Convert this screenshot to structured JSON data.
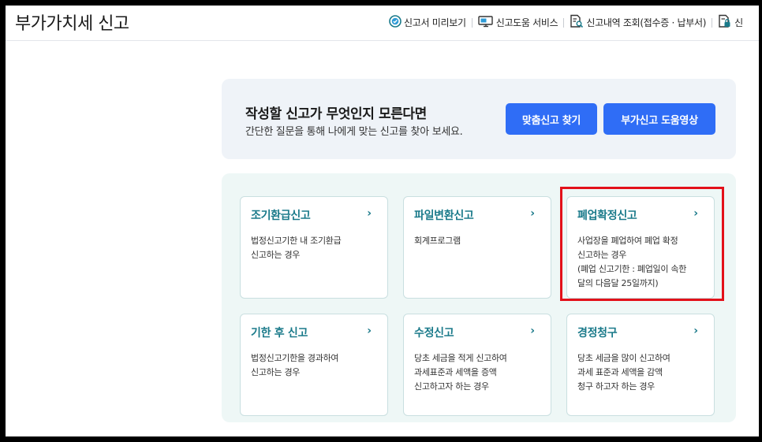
{
  "header": {
    "title": "부가가치세 신고",
    "menu": [
      {
        "label": "신고서 미리보기",
        "icon": "check-circle-icon"
      },
      {
        "label": "신고도움 서비스",
        "icon": "monitor-icon"
      },
      {
        "label": "신고내역 조회(접수증 · 납부서)",
        "icon": "document-search-icon"
      },
      {
        "label": "신",
        "icon": "document-lock-icon"
      }
    ]
  },
  "hint": {
    "title": "작성할 신고가 무엇인지 모른다면",
    "subtitle": "간단한 질문을 통해 나에게 맞는 신고를 찾아 보세요.",
    "button_find": "맞춤신고 찾기",
    "button_video": "부가신고 도움영상"
  },
  "cards": [
    {
      "title": "조기환급신고",
      "lines": [
        "법정신고기한 내 조기환급",
        "신고하는 경우"
      ]
    },
    {
      "title": "파일변환신고",
      "lines": [
        "회계프로그램"
      ]
    },
    {
      "title": "폐업확정신고",
      "lines": [
        "사업장을 폐업하여 폐업 확정",
        "신고하는 경우",
        "(폐업 신고기한 : 폐업일이 속한",
        "달의 다음달 25일까지)"
      ]
    },
    {
      "title": "기한 후 신고",
      "lines": [
        "법정신고기한을 경과하여",
        "신고하는 경우"
      ]
    },
    {
      "title": "수정신고",
      "lines": [
        "당초 세금을 적게 신고하여",
        "과세표준과 세액을 증액",
        "신고하고자 하는 경우"
      ]
    },
    {
      "title": "경정청구",
      "lines": [
        "당초 세금을 많이 신고하여",
        "과세 표준과 세액을 감액",
        "청구 하고자 하는 경우"
      ]
    }
  ],
  "arrow_glyph": "›",
  "colors": {
    "accent_blue": "#2f6df6",
    "card_title_teal": "#1a7a8a",
    "highlight_red": "#e3111a"
  }
}
